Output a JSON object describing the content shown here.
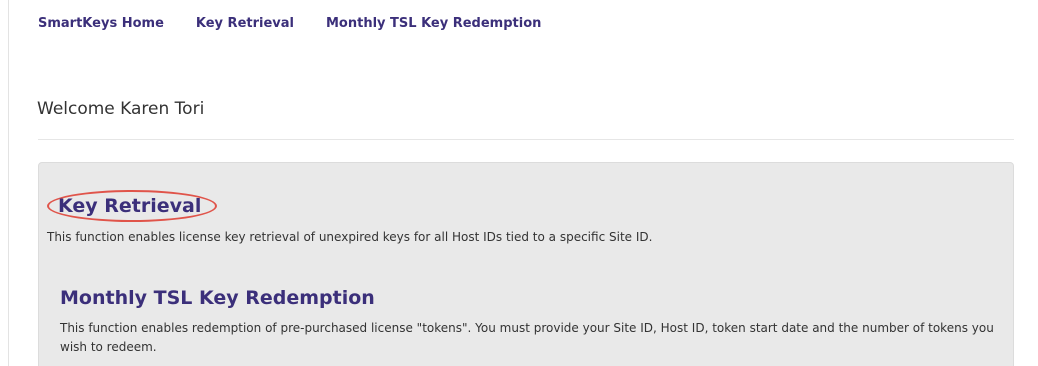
{
  "nav": {
    "home": "SmartKeys Home",
    "key_retrieval": "Key Retrieval",
    "tsl": "Monthly TSL Key Redemption"
  },
  "welcome": {
    "text": "Welcome Karen Tori"
  },
  "sections": {
    "key_retrieval": {
      "title": "Key Retrieval",
      "description": "This function enables license key retrieval of unexpired keys for all Host IDs tied to a specific Site ID.",
      "highlight_color": "#e0544a"
    },
    "tsl": {
      "title": "Monthly TSL Key Redemption",
      "description": "This function enables redemption of pre-purchased license \"tokens\". You must provide your Site ID, Host ID, token start date and the number of tokens you wish to redeem."
    }
  },
  "colors": {
    "link": "#3b2f7a",
    "panel_bg": "#e9e9e9",
    "text": "#333333"
  }
}
